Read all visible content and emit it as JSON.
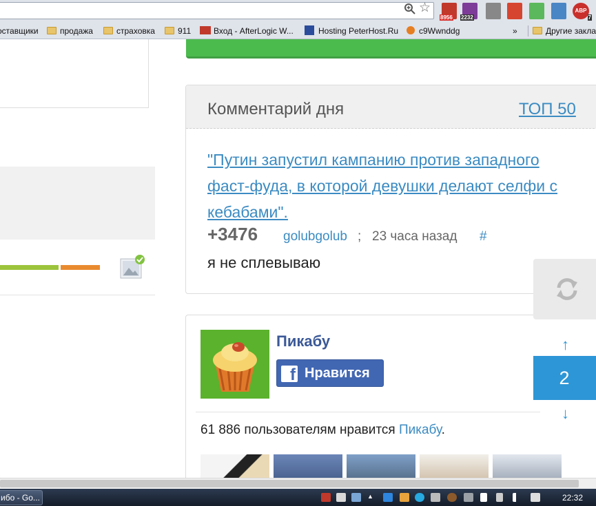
{
  "browser": {
    "ext_badge_1": "8956",
    "ext_badge_2": "2232",
    "ext_abp": "ABP",
    "ext_abp_count": "7",
    "bookmarks": [
      {
        "label": "оставщики",
        "icon": "folder-icon"
      },
      {
        "label": "продажа",
        "icon": "folder-icon"
      },
      {
        "label": "страховка",
        "icon": "folder-icon"
      },
      {
        "label": "911",
        "icon": "folder-icon"
      },
      {
        "label": "Вход - AfterLogic W...",
        "icon": "afterlogic-icon"
      },
      {
        "label": "Hosting PeterHost.Ru",
        "icon": "peterhost-icon"
      },
      {
        "label": "c9Wwnddg",
        "icon": "site-icon"
      }
    ],
    "overflow": "»",
    "other_bookmarks": "Другие заклад"
  },
  "comment_of_day": {
    "title": "Комментарий дня",
    "top_link": "ТОП 50",
    "link_text": "\"Путин запустил кампанию против западного фаст-фуда, в которой девушки делают селфи с кебабами\".",
    "score": "+3476",
    "author": "golubgolub",
    "separator": ";",
    "time_ago": "23 часа назад",
    "hash": "#",
    "text": "я не сплевываю"
  },
  "facebook_widget": {
    "page_name": "Пикабу",
    "like_label": "Нравится",
    "count_text": "61 886 пользователям нравится ",
    "count_link": "Пикабу",
    "count_suffix": "."
  },
  "nav": {
    "page_number": "2",
    "up_arrow": "↑",
    "down_arrow": "↓"
  },
  "taskbar": {
    "task_label": "ибо - Go...",
    "clock": "22:32"
  },
  "colors": {
    "accent_blue": "#2d96d6",
    "link_blue": "#3b8bc2",
    "facebook_blue": "#4267b2",
    "banner_green": "#4cbb4e"
  }
}
